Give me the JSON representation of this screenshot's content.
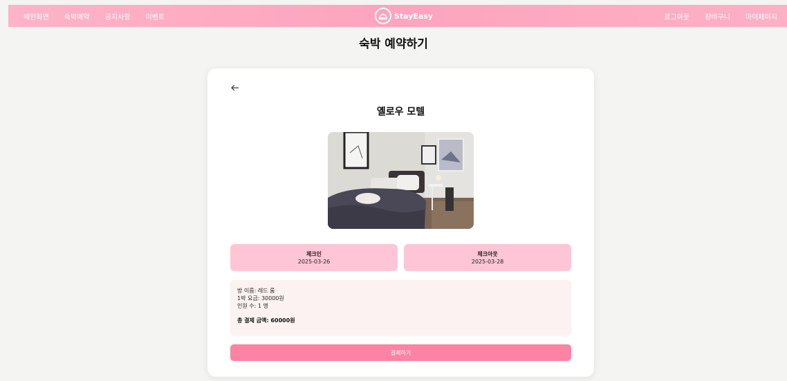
{
  "nav": {
    "left": [
      "메인화면",
      "숙박예약",
      "공지사항",
      "이벤트"
    ],
    "right": [
      "로그아웃",
      "장바구니",
      "마이페이지"
    ],
    "brand": "StayEasy"
  },
  "page": {
    "title": "숙박 예약하기"
  },
  "booking": {
    "hotel_name": "옐로우 모텔",
    "checkin_label": "체크인",
    "checkin_date": "2025-03-26",
    "checkout_label": "체크아웃",
    "checkout_date": "2025-03-28",
    "room_line": "방 이름: 레드 룸",
    "price_line": "1박 요금: 30000원",
    "guests_line": "인원 수: 1 명",
    "total_prefix": "총 결제 금액: ",
    "total_amount": "60000원",
    "pay_button": "결제하기"
  },
  "colors": {
    "nav_bg": "#fda4bf",
    "date_box": "#fec5d6",
    "pay_button": "#fc83a3",
    "summary_bg": "#fdf2f2"
  },
  "icons": {
    "back": "arrow-left-icon",
    "logo": "hotel-bell-icon"
  }
}
